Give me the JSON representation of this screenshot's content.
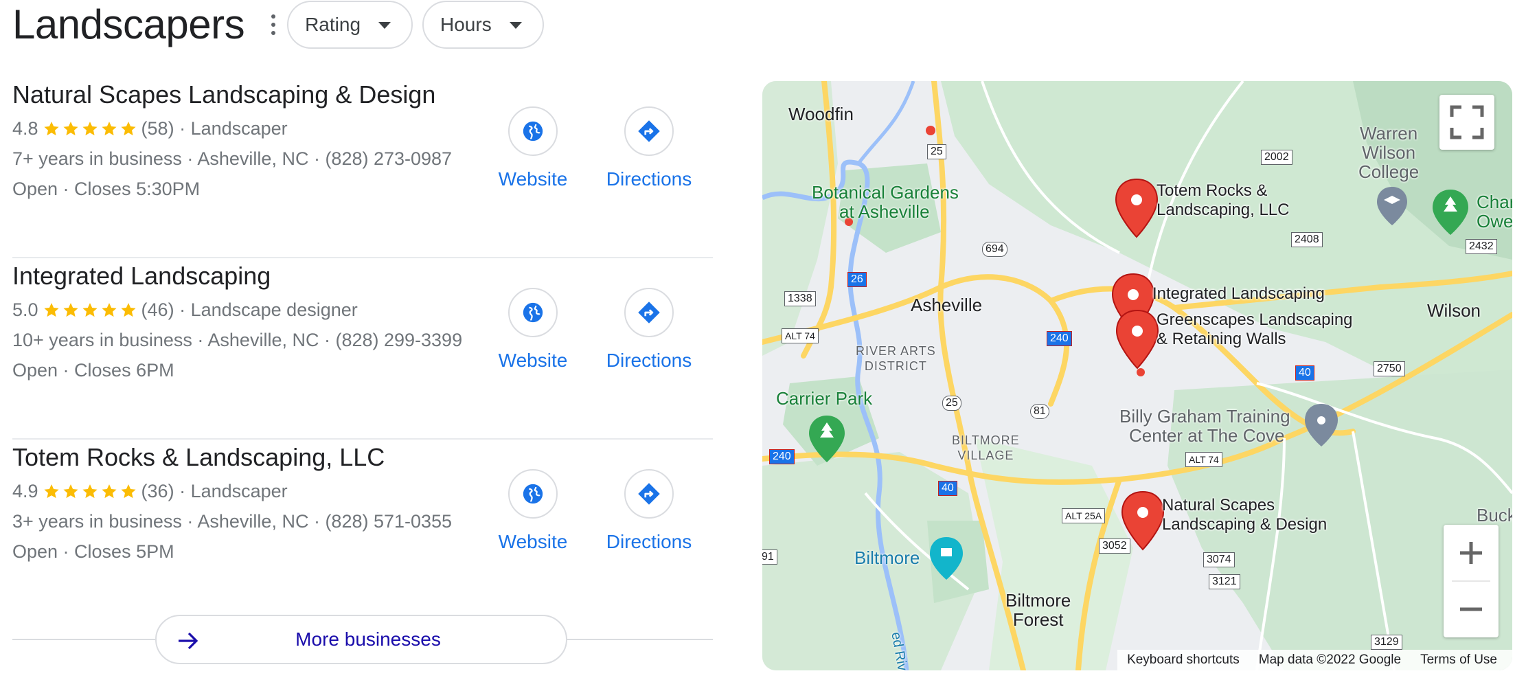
{
  "header": {
    "title": "Landscapers",
    "filters": [
      {
        "label": "Rating"
      },
      {
        "label": "Hours"
      }
    ]
  },
  "results": [
    {
      "name": "Natural Scapes Landscaping & Design",
      "rating": "4.8",
      "stars": 4.8,
      "reviews": "(58)",
      "category": "· Landscaper",
      "details": "7+ years in business · Asheville, NC · (828) 273-0987",
      "hours": "Open · Closes 5:30PM",
      "website_label": "Website",
      "directions_label": "Directions"
    },
    {
      "name": "Integrated Landscaping",
      "rating": "5.0",
      "stars": 5.0,
      "reviews": "(46)",
      "category": "· Landscape designer",
      "details": "10+ years in business · Asheville, NC · (828) 299-3399",
      "hours": "Open · Closes 6PM",
      "website_label": "Website",
      "directions_label": "Directions"
    },
    {
      "name": "Totem Rocks & Landscaping, LLC",
      "rating": "4.9",
      "stars": 4.9,
      "reviews": "(36)",
      "category": "· Landscaper",
      "details": "3+ years in business · Asheville, NC · (828) 571-0355",
      "hours": "Open · Closes 5PM",
      "website_label": "Website",
      "directions_label": "Directions"
    }
  ],
  "more_label": "More businesses",
  "map": {
    "pins": {
      "totem": [
        "Totem Rocks &",
        "Landscaping, LLC"
      ],
      "integrated": [
        "Integrated Landscaping"
      ],
      "greenscapes": [
        "Greenscapes Landscaping",
        "& Retaining Walls"
      ],
      "natural": [
        "Natural Scapes",
        "Landscaping & Design"
      ]
    },
    "places": {
      "woodfin": "Woodfin",
      "botanical": [
        "Botanical Gardens",
        "at Asheville"
      ],
      "asheville": "Asheville",
      "river_arts": [
        "RIVER ARTS",
        "DISTRICT"
      ],
      "carrier_park": "Carrier Park",
      "biltmore_village": [
        "BILTMORE",
        "VILLAGE"
      ],
      "billy_graham": [
        "Billy Graham Training",
        "Center at The Cove"
      ],
      "biltmore": "Biltmore",
      "biltmore_forest": [
        "Biltmore",
        "Forest"
      ],
      "warren_wilson": [
        "Warren",
        "Wilson",
        "College"
      ],
      "wilson": "Wilson",
      "char_owen": [
        "Char",
        "Owen"
      ],
      "buck": "Buck",
      "river": "ed River"
    },
    "roads": [
      "25",
      "2002",
      "694",
      "2408",
      "2432",
      "26",
      "1338",
      "ALT 74",
      "240",
      "40",
      "2750",
      "25",
      "81",
      "240",
      "ALT 74",
      "40",
      "ALT 25A",
      "3052",
      "3074",
      "3121",
      "3129",
      "91"
    ],
    "attribution": {
      "shortcuts": "Keyboard shortcuts",
      "data": "Map data ©2022 Google",
      "terms": "Terms of Use"
    },
    "colors": {
      "pin": "#ea4335",
      "road": "#fdd663",
      "park": "#a8dab5",
      "water": "#9cc0f9"
    }
  }
}
